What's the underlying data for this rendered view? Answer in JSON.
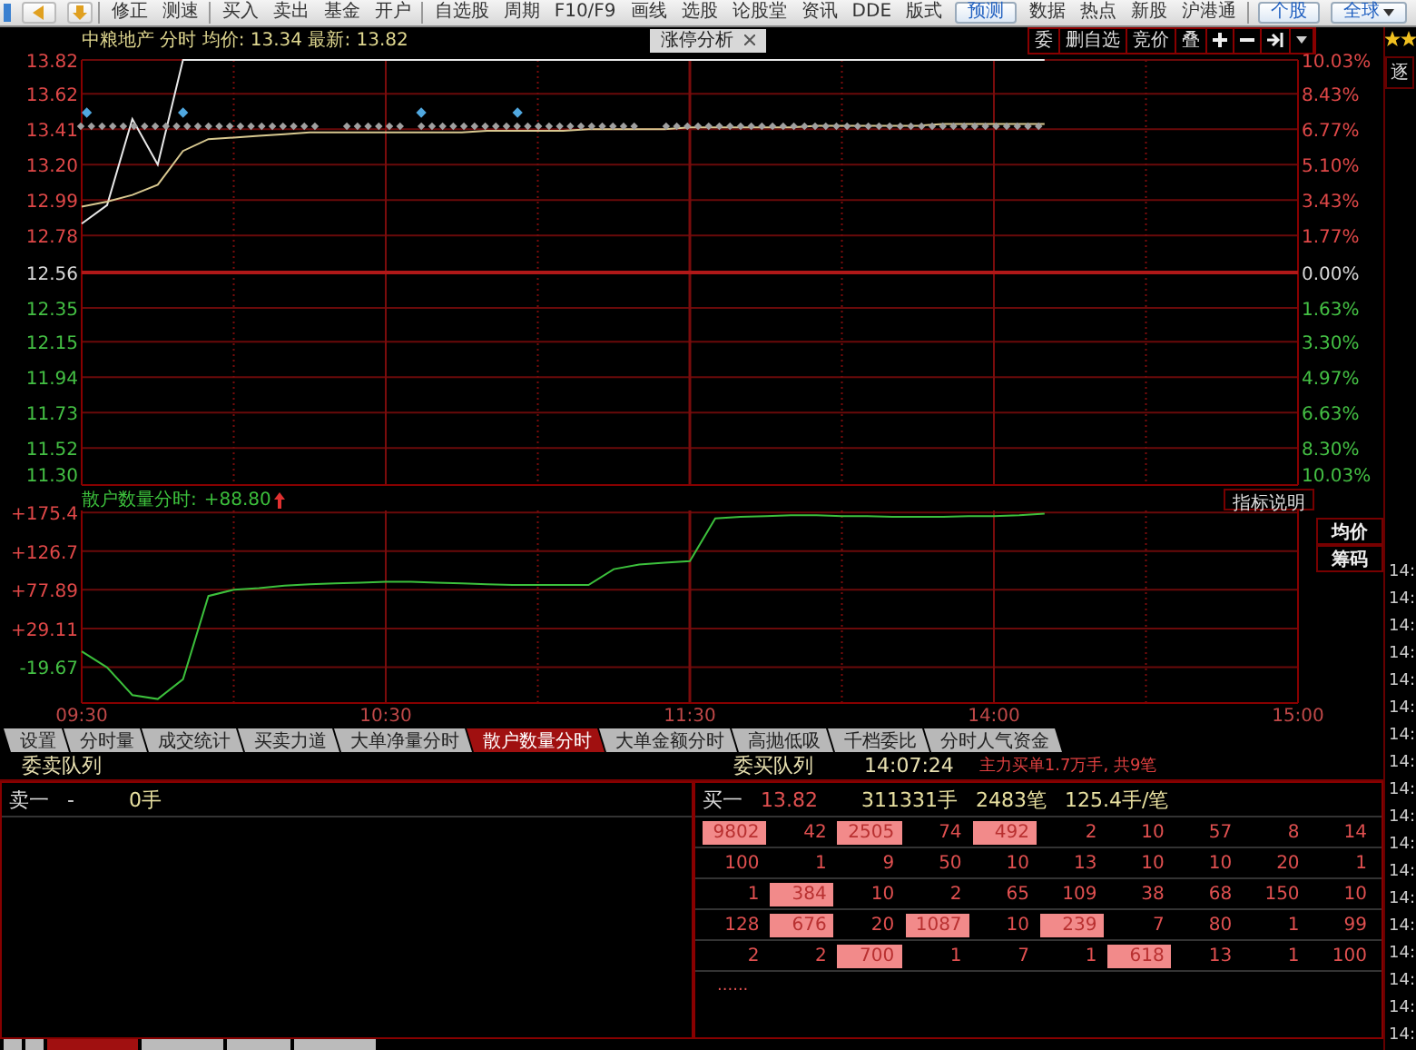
{
  "toolbar": {
    "groups": [
      [
        {
          "label": "修正",
          "kind": "text"
        },
        {
          "label": "测速",
          "kind": "text"
        }
      ],
      [
        {
          "label": "买入",
          "kind": "text"
        },
        {
          "label": "卖出",
          "kind": "text"
        },
        {
          "label": "基金",
          "kind": "text"
        },
        {
          "label": "开户",
          "kind": "text"
        }
      ],
      [
        {
          "label": "自选股",
          "kind": "text"
        },
        {
          "label": "周期",
          "kind": "text"
        },
        {
          "label": "F10/F9",
          "kind": "text"
        },
        {
          "label": "画线",
          "kind": "text"
        },
        {
          "label": "选股",
          "kind": "text"
        },
        {
          "label": "论股堂",
          "kind": "text"
        },
        {
          "label": "资讯",
          "kind": "text"
        },
        {
          "label": "DDE",
          "kind": "text"
        },
        {
          "label": "版式",
          "kind": "text"
        },
        {
          "label": "预测",
          "kind": "button"
        },
        {
          "label": "数据",
          "kind": "text"
        },
        {
          "label": "热点",
          "kind": "text"
        },
        {
          "label": "新股",
          "kind": "text"
        },
        {
          "label": "沪港通",
          "kind": "text"
        }
      ],
      [
        {
          "label": "个股",
          "kind": "button"
        },
        {
          "label": "全球",
          "kind": "dropdown"
        }
      ]
    ]
  },
  "chart_header": {
    "title": "中粮地产 分时 均价: 13.34 最新: 13.82",
    "tab": {
      "label": "涨停分析",
      "selected": true
    },
    "tools": [
      "委",
      "删自选",
      "竞价",
      "叠"
    ]
  },
  "price_chart": {
    "percent_labels": [
      "10.03%",
      "8.43%",
      "6.77%",
      "5.10%",
      "3.43%",
      "1.77%",
      "0.00%",
      "1.63%",
      "3.30%",
      "4.97%",
      "6.63%",
      "8.30%",
      "10.03%"
    ],
    "chart_data": {
      "type": "line",
      "grid": true,
      "ylim": [
        11.3,
        13.82
      ],
      "ref_lines": [
        {
          "axis": "y",
          "value": 12.56
        }
      ],
      "yticks": [
        {
          "value": 13.82,
          "label": "13.82"
        },
        {
          "value": 13.62,
          "label": "13.62"
        },
        {
          "value": 13.41,
          "label": "13.41"
        },
        {
          "value": 13.2,
          "label": "13.20"
        },
        {
          "value": 12.99,
          "label": "12.99"
        },
        {
          "value": 12.78,
          "label": "12.78"
        },
        {
          "value": 12.56,
          "label": "12.56"
        },
        {
          "value": 12.35,
          "label": "12.35"
        },
        {
          "value": 12.15,
          "label": "12.15"
        },
        {
          "value": 11.94,
          "label": "11.94"
        },
        {
          "value": 11.73,
          "label": "11.73"
        },
        {
          "value": 11.52,
          "label": "11.52"
        },
        {
          "value": 11.3,
          "label": "11.30"
        }
      ],
      "categories": [
        null,
        null,
        null,
        null,
        null,
        null,
        null,
        null,
        null,
        null,
        null,
        null,
        null,
        null,
        null,
        null,
        null,
        null,
        null,
        null,
        null,
        null,
        null,
        null,
        null,
        null,
        null,
        null,
        null,
        null,
        null,
        null,
        null,
        null,
        null,
        null,
        null,
        null,
        null,
        null,
        null,
        null,
        null,
        null,
        null,
        null,
        null,
        null,
        null
      ],
      "series": [
        {
          "color": "#e8e8e8",
          "values": [
            12.85,
            12.96,
            13.47,
            13.2,
            13.82,
            13.82,
            13.82,
            13.82,
            13.82,
            13.82,
            13.82,
            13.82,
            13.82,
            13.82,
            13.82,
            13.82,
            13.82,
            13.82,
            13.82,
            13.82,
            13.82,
            13.82,
            13.82,
            13.82,
            13.82,
            13.82,
            13.82,
            13.82,
            13.82,
            13.82,
            13.82,
            13.82,
            13.82,
            13.82,
            13.82,
            13.82,
            13.82,
            13.82,
            13.82,
            null,
            null,
            null,
            null,
            null,
            null,
            null,
            null,
            null,
            null
          ]
        },
        {
          "color": "#d8c890",
          "values": [
            12.95,
            12.98,
            13.02,
            13.08,
            13.28,
            13.35,
            13.36,
            13.37,
            13.38,
            13.39,
            13.39,
            13.39,
            13.39,
            13.39,
            13.39,
            13.39,
            13.4,
            13.4,
            13.4,
            13.4,
            13.41,
            13.41,
            13.41,
            13.41,
            13.42,
            13.42,
            13.42,
            13.42,
            13.42,
            13.43,
            13.43,
            13.43,
            13.43,
            13.43,
            13.44,
            13.44,
            13.44,
            13.44,
            13.44,
            null,
            null,
            null,
            null,
            null,
            null,
            null,
            null,
            null,
            null
          ]
        }
      ]
    }
  },
  "indicator": {
    "label": "散户数量分时:",
    "reading": "+88.80",
    "help_button": "指标说明",
    "side_buttons": [
      "均价",
      "筹码"
    ],
    "chart_data": {
      "type": "line",
      "grid": true,
      "ylim": [
        -65,
        178
      ],
      "yticks": [
        {
          "value": 175.4,
          "label": "+175.4"
        },
        {
          "value": 126.7,
          "label": "+126.7"
        },
        {
          "value": 77.89,
          "label": "+77.89"
        },
        {
          "value": 29.11,
          "label": "+29.11"
        },
        {
          "value": -19.67,
          "label": "-19.67"
        }
      ],
      "categories": [
        "09:30",
        null,
        null,
        null,
        null,
        null,
        null,
        null,
        null,
        null,
        null,
        null,
        "10:30",
        null,
        null,
        null,
        null,
        null,
        null,
        null,
        null,
        null,
        null,
        null,
        "11:30",
        null,
        null,
        null,
        null,
        null,
        null,
        null,
        null,
        null,
        null,
        null,
        "14:00",
        null,
        null,
        null,
        null,
        null,
        null,
        null,
        null,
        null,
        null,
        null,
        "15:00"
      ],
      "series": [
        {
          "color": "#3cc03c",
          "values": [
            0,
            -20,
            -55,
            -60,
            -35,
            70,
            78,
            80,
            83,
            85,
            86,
            87,
            88,
            88,
            87,
            86,
            85,
            84,
            84,
            84,
            84,
            104,
            110,
            112,
            114,
            168,
            170,
            171,
            172,
            172,
            171,
            171,
            170,
            170,
            170,
            171,
            171,
            172,
            174,
            null,
            null,
            null,
            null,
            null,
            null,
            null,
            null,
            null,
            null
          ]
        }
      ]
    }
  },
  "indicator_tabs": [
    {
      "label": "设置",
      "selected": false
    },
    {
      "label": "分时量",
      "selected": false
    },
    {
      "label": "成交统计",
      "selected": false
    },
    {
      "label": "买卖力道",
      "selected": false
    },
    {
      "label": "大单净量分时",
      "selected": false
    },
    {
      "label": "散户数量分时",
      "selected": true
    },
    {
      "label": "大单金额分时",
      "selected": false
    },
    {
      "label": "高抛低吸",
      "selected": false
    },
    {
      "label": "千档委比",
      "selected": false
    },
    {
      "label": "分时人气资金",
      "selected": false
    }
  ],
  "queue_header": {
    "sell_title": "委卖队列",
    "buy_title": "委买队列",
    "time": "14:07:24",
    "note": "主力买单1.7万手, 共9笔"
  },
  "sell_queue": {
    "level": "卖一",
    "price": "-",
    "volume": "0手"
  },
  "buy_queue": {
    "level": "买一",
    "price": "13.82",
    "volume": "311331手",
    "orders": "2483笔",
    "average": "125.4手/笔",
    "more": "......",
    "rows": [
      [
        {
          "value": "9802",
          "highlighted": true
        },
        {
          "value": "42",
          "highlighted": false
        },
        {
          "value": "2505",
          "highlighted": true
        },
        {
          "value": "74",
          "highlighted": false
        },
        {
          "value": "492",
          "highlighted": true
        },
        {
          "value": "2",
          "highlighted": false
        },
        {
          "value": "10",
          "highlighted": false
        },
        {
          "value": "57",
          "highlighted": false
        },
        {
          "value": "8",
          "highlighted": false
        },
        {
          "value": "14",
          "highlighted": false
        }
      ],
      [
        {
          "value": "100",
          "highlighted": false
        },
        {
          "value": "1",
          "highlighted": false
        },
        {
          "value": "9",
          "highlighted": false
        },
        {
          "value": "50",
          "highlighted": false
        },
        {
          "value": "10",
          "highlighted": false
        },
        {
          "value": "13",
          "highlighted": false
        },
        {
          "value": "10",
          "highlighted": false
        },
        {
          "value": "10",
          "highlighted": false
        },
        {
          "value": "20",
          "highlighted": false
        },
        {
          "value": "1",
          "highlighted": false
        }
      ],
      [
        {
          "value": "1",
          "highlighted": false
        },
        {
          "value": "384",
          "highlighted": true
        },
        {
          "value": "10",
          "highlighted": false
        },
        {
          "value": "2",
          "highlighted": false
        },
        {
          "value": "65",
          "highlighted": false
        },
        {
          "value": "109",
          "highlighted": false
        },
        {
          "value": "38",
          "highlighted": false
        },
        {
          "value": "68",
          "highlighted": false
        },
        {
          "value": "150",
          "highlighted": false
        },
        {
          "value": "10",
          "highlighted": false
        }
      ],
      [
        {
          "value": "128",
          "highlighted": false
        },
        {
          "value": "676",
          "highlighted": true
        },
        {
          "value": "20",
          "highlighted": false
        },
        {
          "value": "1087",
          "highlighted": true
        },
        {
          "value": "10",
          "highlighted": false
        },
        {
          "value": "239",
          "highlighted": true
        },
        {
          "value": "7",
          "highlighted": false
        },
        {
          "value": "80",
          "highlighted": false
        },
        {
          "value": "1",
          "highlighted": false
        },
        {
          "value": "99",
          "highlighted": false
        }
      ],
      [
        {
          "value": "2",
          "highlighted": false
        },
        {
          "value": "2",
          "highlighted": false
        },
        {
          "value": "700",
          "highlighted": true
        },
        {
          "value": "1",
          "highlighted": false
        },
        {
          "value": "7",
          "highlighted": false
        },
        {
          "value": "1",
          "highlighted": false
        },
        {
          "value": "618",
          "highlighted": true
        },
        {
          "value": "13",
          "highlighted": false
        },
        {
          "value": "1",
          "highlighted": false
        },
        {
          "value": "100",
          "highlighted": false
        }
      ]
    ]
  },
  "bottom_tabs": [
    {
      "selected": false
    },
    {
      "selected": false
    },
    {
      "selected": true
    },
    {
      "selected": false
    },
    {
      "selected": false
    },
    {
      "selected": false
    }
  ],
  "side_strip": {
    "title": "逐",
    "times": [
      "14:",
      "14:",
      "14:",
      "14:",
      "14:",
      "14:",
      "14:",
      "14:",
      "14:",
      "14:",
      "14:",
      "14:",
      "14:",
      "14:",
      "14:",
      "14:",
      "14:",
      "14:"
    ]
  }
}
